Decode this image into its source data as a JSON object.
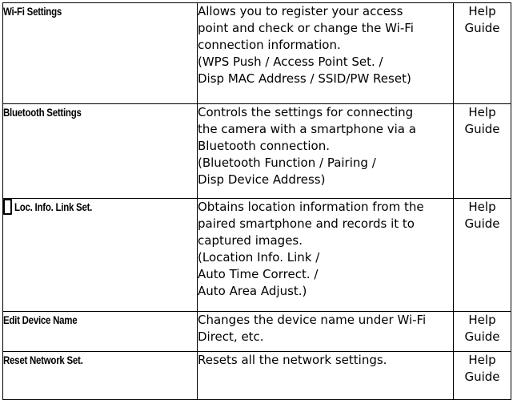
{
  "rows": [
    {
      "name": "Wi-Fi Settings",
      "desc": [
        "Allows you to register your access",
        "point and check or change the Wi-Fi",
        "connection information.",
        "(WPS Push / Access Point Set. /",
        "Disp MAC Address / SSID/PW Reset)"
      ],
      "help": [
        "Help",
        "Guide"
      ]
    },
    {
      "name": "Bluetooth Settings",
      "desc": [
        "Controls the settings for connecting",
        "the camera with a smartphone via a",
        "Bluetooth connection.",
        "(Bluetooth Function / Pairing /",
        "Disp Device Address)"
      ],
      "help": [
        "Help",
        "Guide"
      ]
    },
    {
      "name": "Loc. Info. Link Set.",
      "icon": "smartphone-icon",
      "desc": [
        "Obtains location information from the",
        "paired smartphone and records it to",
        "captured images.",
        "(Location Info. Link /",
        "Auto Time Correct. /",
        "Auto Area Adjust.)"
      ],
      "help": [
        "Help",
        "Guide"
      ]
    },
    {
      "name": "Edit Device Name",
      "desc": [
        "Changes the device name under Wi-Fi",
        "Direct, etc."
      ],
      "help": [
        "Help",
        "Guide"
      ]
    },
    {
      "name": "Reset Network Set.",
      "desc": [
        "Resets all the network settings."
      ],
      "help": [
        "Help",
        "Guide"
      ]
    }
  ]
}
